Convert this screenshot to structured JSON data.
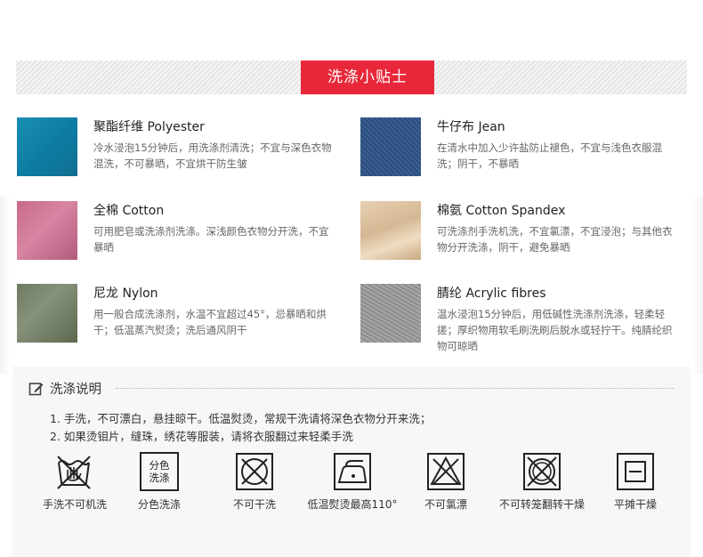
{
  "banner": {
    "title": "洗涤小贴士"
  },
  "fabrics": [
    {
      "name": "聚酯纤维 Polyester",
      "desc": "冷水浸泡15分钟后，用洗涤剂清洗；不宜与深色衣物混洗，不可暴晒，不宜烘干防生皱",
      "swatch_color": "#1a8fb3"
    },
    {
      "name": "牛仔布 Jean",
      "desc": "在清水中加入少许盐防止褪色，不宜与浅色衣服混洗；阴干，不暴晒",
      "swatch_color": "#2f527f"
    },
    {
      "name": "全棉 Cotton",
      "desc": "可用肥皂或洗涤剂洗涤。深浅颜色衣物分开洗，不宜暴晒",
      "swatch_color": "#c76a8c"
    },
    {
      "name": "棉氨 Cotton Spandex",
      "desc": "可洗涤剂手洗机洗，不宜氯漂，不宜浸泡；与其他衣物分开洗涤，阴干，避免暴晒",
      "swatch_color": "#e0c7a6"
    },
    {
      "name": "尼龙 Nylon",
      "desc": "用一般合成洗涤剂，水温不宜超过45°，忌暴晒和烘干；低温蒸汽熨烫；洗后通风阴干",
      "swatch_color": "#6f7a63"
    },
    {
      "name": "腈纶 Acrylic fibres",
      "desc": "温水浸泡15分钟后，用低碱性洗涤剂洗涤，轻柔轻搓；厚织物用软毛刷洗刷后脱水或轻拧干。纯腈纶织物可晾晒",
      "swatch_color": "#999999"
    }
  ],
  "wash": {
    "title": "洗涤说明",
    "items": [
      "1. 手洗，不可漂白，悬挂晾干。低温熨烫，常规干洗请将深色衣物分开来洗；",
      "2. 如果烫钼片，缝珠，绣花等服装，请将衣服翻过来轻柔手洗"
    ],
    "icons": [
      {
        "icon": "hand-wash-no-machine-icon",
        "label": "手洗不可机洗"
      },
      {
        "icon": "separate-wash-icon",
        "label": "分色洗涤",
        "icon_text_1": "分色",
        "icon_text_2": "洗涤"
      },
      {
        "icon": "no-dry-clean-icon",
        "label": "不可干洗"
      },
      {
        "icon": "low-temp-iron-icon",
        "label": "低温熨烫最高110°"
      },
      {
        "icon": "no-bleach-icon",
        "label": "不可氯漂"
      },
      {
        "icon": "no-tumble-dry-icon",
        "label": "不可转笼翻转干燥"
      },
      {
        "icon": "flat-dry-icon",
        "label": "平摊干燥"
      }
    ]
  }
}
